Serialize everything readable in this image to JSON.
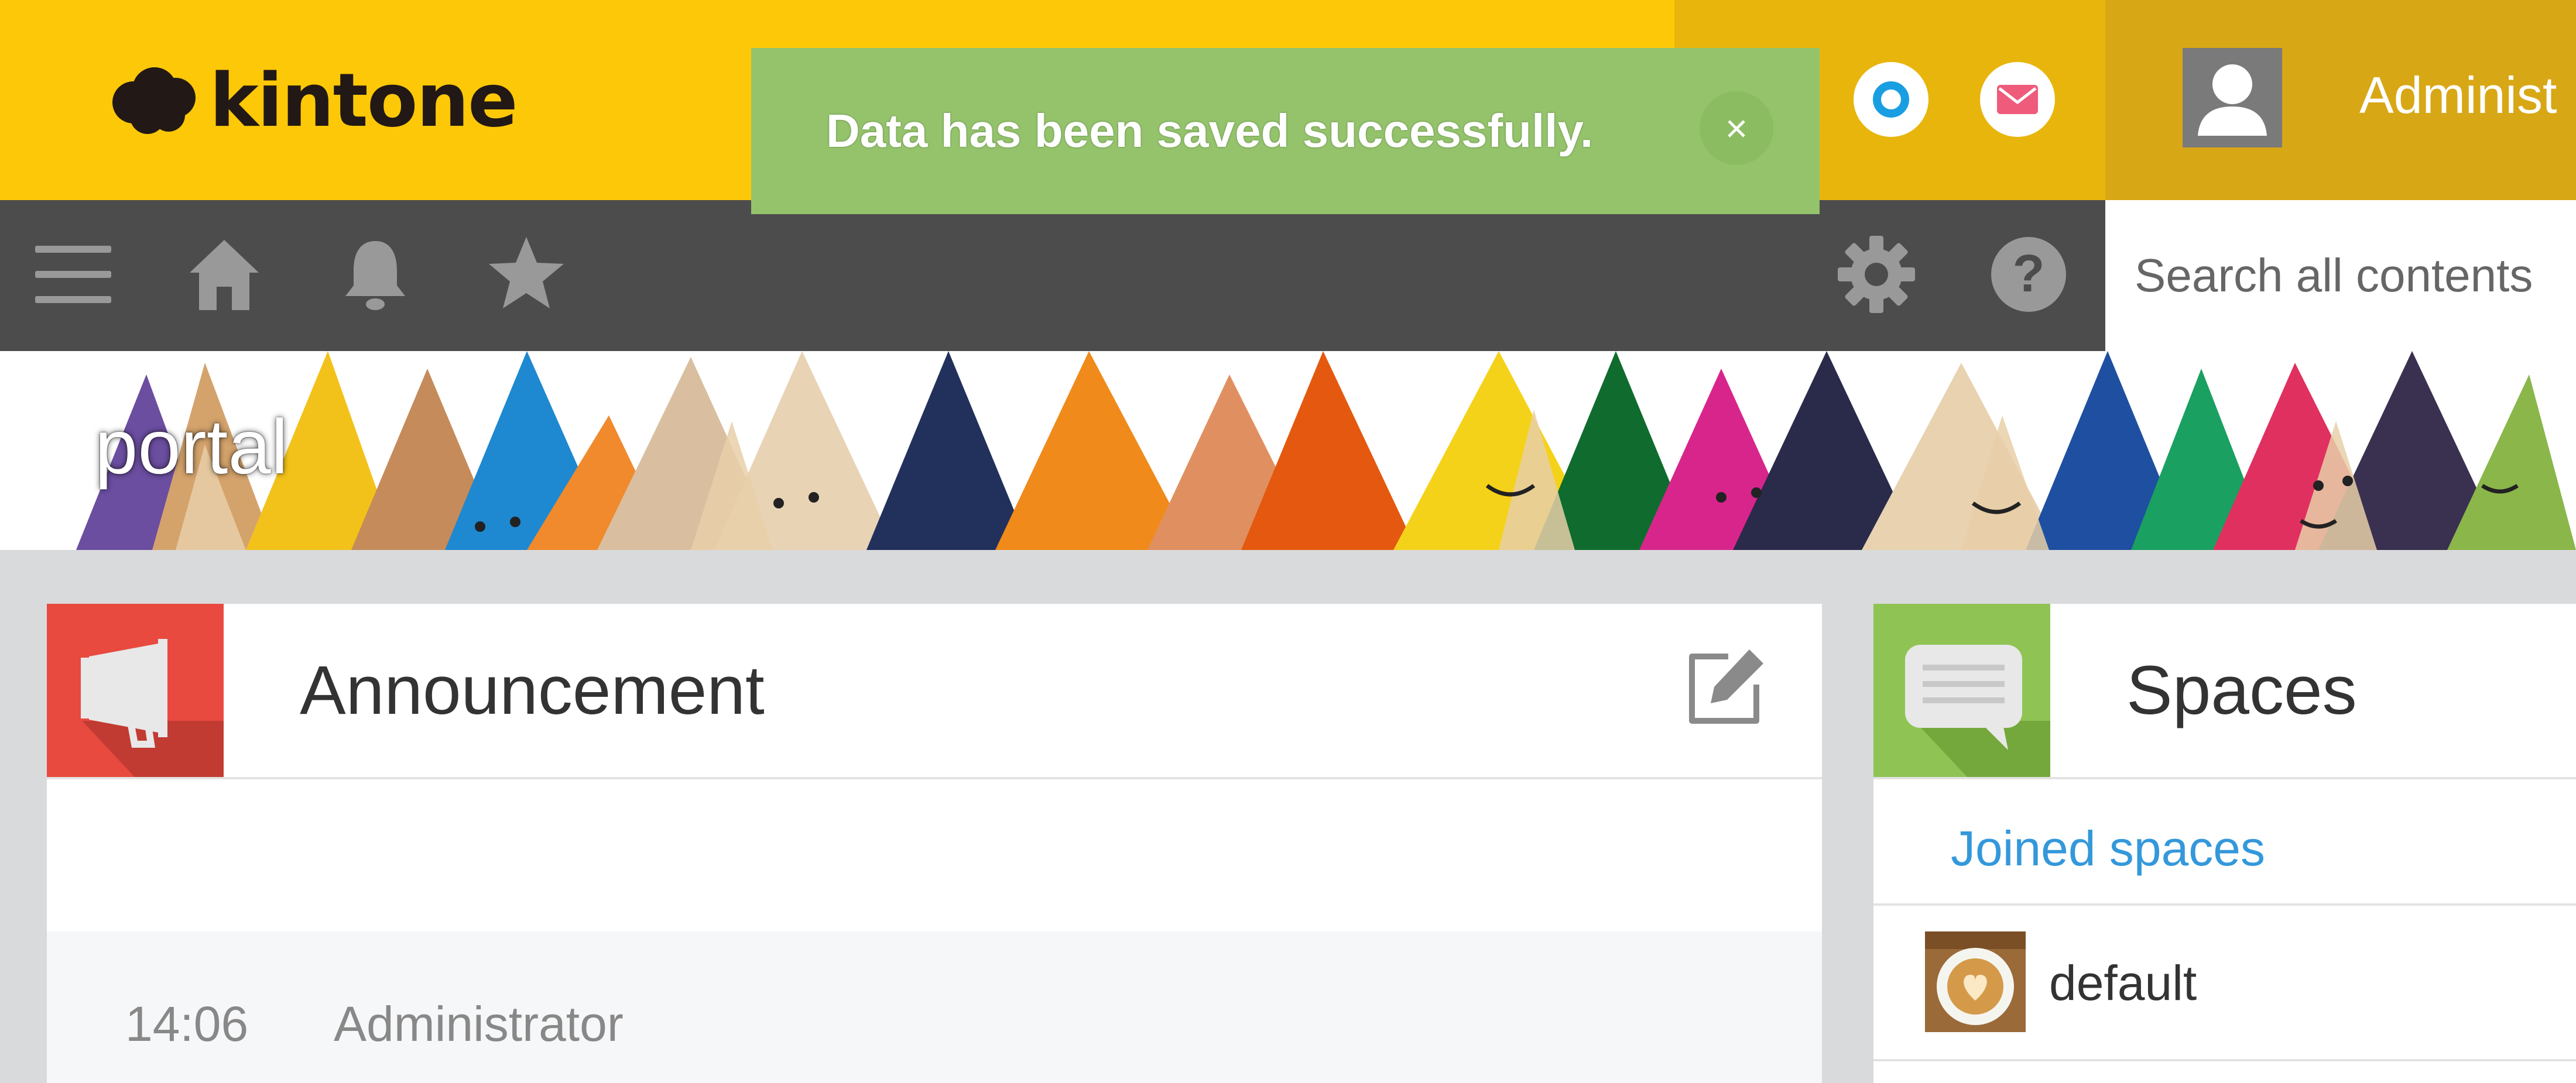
{
  "header": {
    "logo_text": "kintone",
    "user_name": "Administ",
    "colors": {
      "primary": "#fdc807",
      "nav": "#4c4c4c"
    }
  },
  "toast": {
    "message": "Data has been saved successfully.",
    "close_label": "×",
    "color": "#94c36c"
  },
  "nav": {
    "icons": [
      "menu-icon",
      "home-icon",
      "bell-icon",
      "star-icon",
      "gear-icon",
      "help-icon"
    ],
    "search_placeholder": "Search all contents"
  },
  "banner": {
    "title": "portal"
  },
  "announcement": {
    "title": "Announcement",
    "post": {
      "time": "14:06",
      "author": "Administrator"
    }
  },
  "spaces": {
    "title": "Spaces",
    "joined_label": "Joined spaces",
    "items": [
      {
        "name": "default"
      }
    ]
  }
}
